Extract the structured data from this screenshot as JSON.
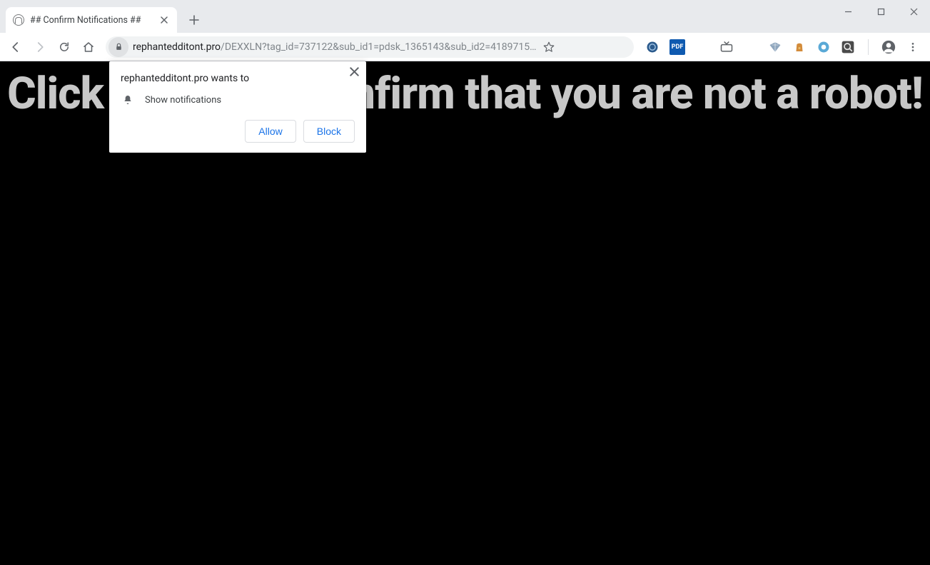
{
  "tab": {
    "title": "## Confirm Notifications ##"
  },
  "url": {
    "host": "rephantedditont.pro",
    "path": "/DEXXLN?tag_id=737122&sub_id1=pdsk_1365143&sub_id2=4189715…"
  },
  "extensions": {
    "pdf_label": "PDF"
  },
  "page": {
    "hero_text": "Click \"Allow\" to confirm that you are not a robot!"
  },
  "permission_popup": {
    "title": "rephantedditont.pro wants to",
    "body": "Show notifications",
    "allow": "Allow",
    "block": "Block"
  }
}
